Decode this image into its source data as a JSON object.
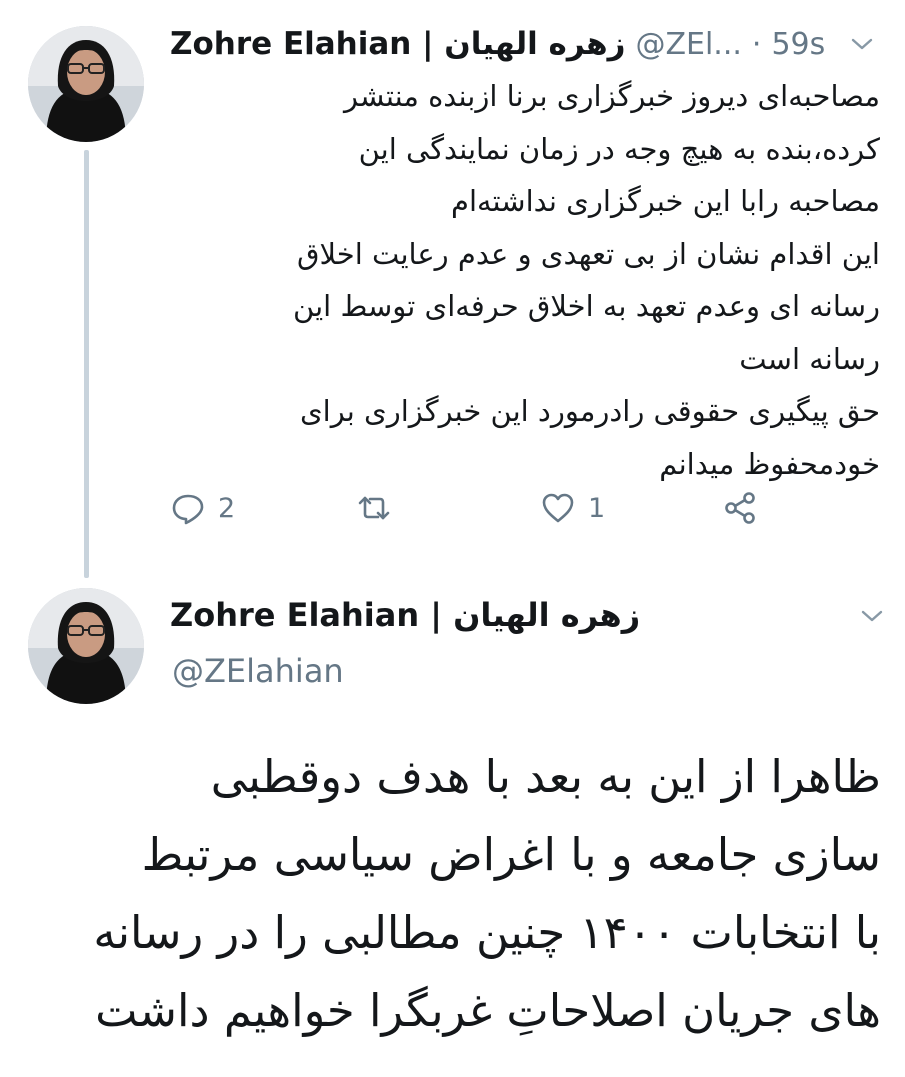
{
  "tweet1": {
    "author_name": "Zohre Elahian | زهره الهیان",
    "handle": "@ZEl...",
    "separator": "·",
    "time": "59s",
    "text_lines": [
      "مصاحبه‌ای دیروز خبرگزاری برنا ازبنده منتشر",
      "کرده،بنده به هیچ وجه در زمان نمایندگی این",
      "مصاحبه رابا این خبرگزاری نداشته‌ام",
      "این اقدام نشان از بی تعهدی و عدم رعایت اخلاق",
      "رسانه ای وعدم تعهد به اخلاق حرفه‌ای توسط این",
      "رسانه است",
      "حق پیگیری حقوقی رادرمورد این خبرگزاری برای",
      "خودمحفوظ میدانم"
    ],
    "reply_count": "2",
    "retweet_count": "",
    "like_count": "1"
  },
  "tweet2": {
    "author_name": "Zohre Elahian | زهره الهیان",
    "handle": "@ZElahian",
    "text_lines": [
      "ظاهرا از این به بعد با هدف دوقطبی",
      "سازی جامعه و با اغراض سیاسی مرتبط",
      "با انتخابات ۱۴۰۰ چنین مطالبی را در رسانه",
      "های جریان اصلاحاتِ غربگرا خواهیم داشت"
    ]
  },
  "icons": {
    "reply": "reply-icon",
    "retweet": "retweet-icon",
    "like": "heart-icon",
    "share": "share-icon",
    "menu": "chevron-down-icon"
  },
  "colors": {
    "text": "#14171a",
    "secondary": "#657786",
    "thread_line": "#c8d3dc"
  }
}
